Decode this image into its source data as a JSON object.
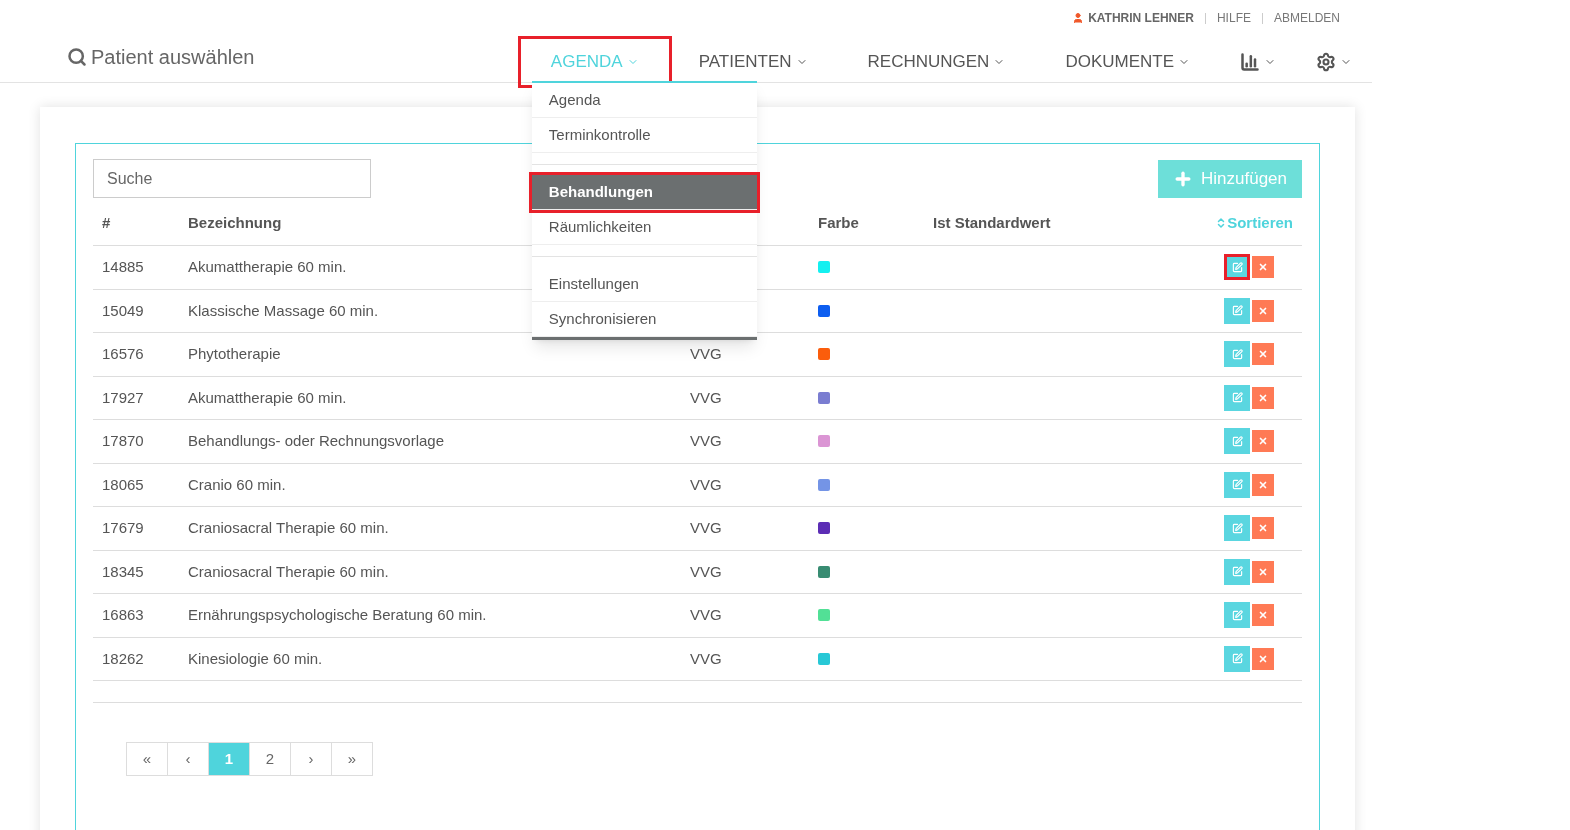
{
  "user_bar": {
    "user": "KATHRIN LEHNER",
    "links": [
      "HILFE",
      "ABMELDEN"
    ]
  },
  "header": {
    "search_label": "Patient auswählen",
    "nav": [
      {
        "kind": "text",
        "label": "AGENDA",
        "selected": true,
        "highlighted": true
      },
      {
        "kind": "text",
        "label": "PATIENTEN",
        "selected": false,
        "highlighted": false
      },
      {
        "kind": "text",
        "label": "RECHNUNGEN",
        "selected": false,
        "highlighted": false
      },
      {
        "kind": "text",
        "label": "DOKUMENTE",
        "selected": false,
        "highlighted": false
      },
      {
        "kind": "chart",
        "selected": false,
        "highlighted": false
      },
      {
        "kind": "settings",
        "selected": false,
        "highlighted": false
      }
    ]
  },
  "dropdown": {
    "items": [
      {
        "kind": "item",
        "label": "Agenda",
        "selected": false,
        "highlighted": false
      },
      {
        "kind": "item",
        "label": "Terminkontrolle",
        "selected": false,
        "highlighted": false
      },
      {
        "kind": "divider"
      },
      {
        "kind": "item",
        "label": "Behandlungen",
        "selected": true,
        "highlighted": true
      },
      {
        "kind": "item",
        "label": "Räumlichkeiten",
        "selected": false,
        "highlighted": false
      },
      {
        "kind": "divider"
      },
      {
        "kind": "item",
        "label": "Einstellungen",
        "selected": false,
        "highlighted": false
      },
      {
        "kind": "item",
        "label": "Synchronisieren",
        "selected": false,
        "highlighted": false
      }
    ]
  },
  "search": {
    "placeholder": "Suche"
  },
  "add_button": "Hinzufügen",
  "table": {
    "columns": [
      "#",
      "Bezeichnung",
      "",
      "Farbe",
      "Ist Standardwert",
      "Sortieren"
    ],
    "rows": [
      {
        "id": "14885",
        "name": "Akumattherapie 60 min.",
        "color": "#14f0f0",
        "edit_highlighted": true
      },
      {
        "id": "15049",
        "name": "Klassische Massage 60 min.",
        "color": "#0d5ef0",
        "edit_highlighted": false
      },
      {
        "id": "16576",
        "name": "Phytotherapie",
        "column_3": "VVG",
        "color": "#fb5d0c",
        "edit_highlighted": false
      },
      {
        "id": "17927",
        "name": "Akumattherapie 60 min.",
        "column_3": "VVG",
        "color": "#7a7dd1",
        "edit_highlighted": false
      },
      {
        "id": "17870",
        "name": "Behandlungs- oder Rechnungsvorlage",
        "column_3": "VVG",
        "color": "#db95d4",
        "edit_highlighted": false
      },
      {
        "id": "18065",
        "name": "Cranio 60 min.",
        "column_3": "VVG",
        "color": "#7494e6",
        "edit_highlighted": false
      },
      {
        "id": "17679",
        "name": "Craniosacral Therapie 60 min.",
        "column_3": "VVG",
        "color": "#5c2db5",
        "edit_highlighted": false
      },
      {
        "id": "18345",
        "name": "Craniosacral Therapie 60 min.",
        "column_3": "VVG",
        "color": "#388c72",
        "edit_highlighted": false
      },
      {
        "id": "16863",
        "name": "Ernährungspsychologische Beratung 60 min.",
        "column_3": "VVG",
        "color": "#52e096",
        "edit_highlighted": false
      },
      {
        "id": "18262",
        "name": "Kinesiologie 60 min.",
        "column_3": "VVG",
        "color": "#28c8d6",
        "edit_highlighted": false
      }
    ]
  },
  "pagination": [
    {
      "label": "«",
      "selected": false
    },
    {
      "label": "‹",
      "selected": false
    },
    {
      "label": "1",
      "selected": true
    },
    {
      "label": "2",
      "selected": false
    },
    {
      "label": "›",
      "selected": false
    },
    {
      "label": "»",
      "selected": false
    }
  ]
}
